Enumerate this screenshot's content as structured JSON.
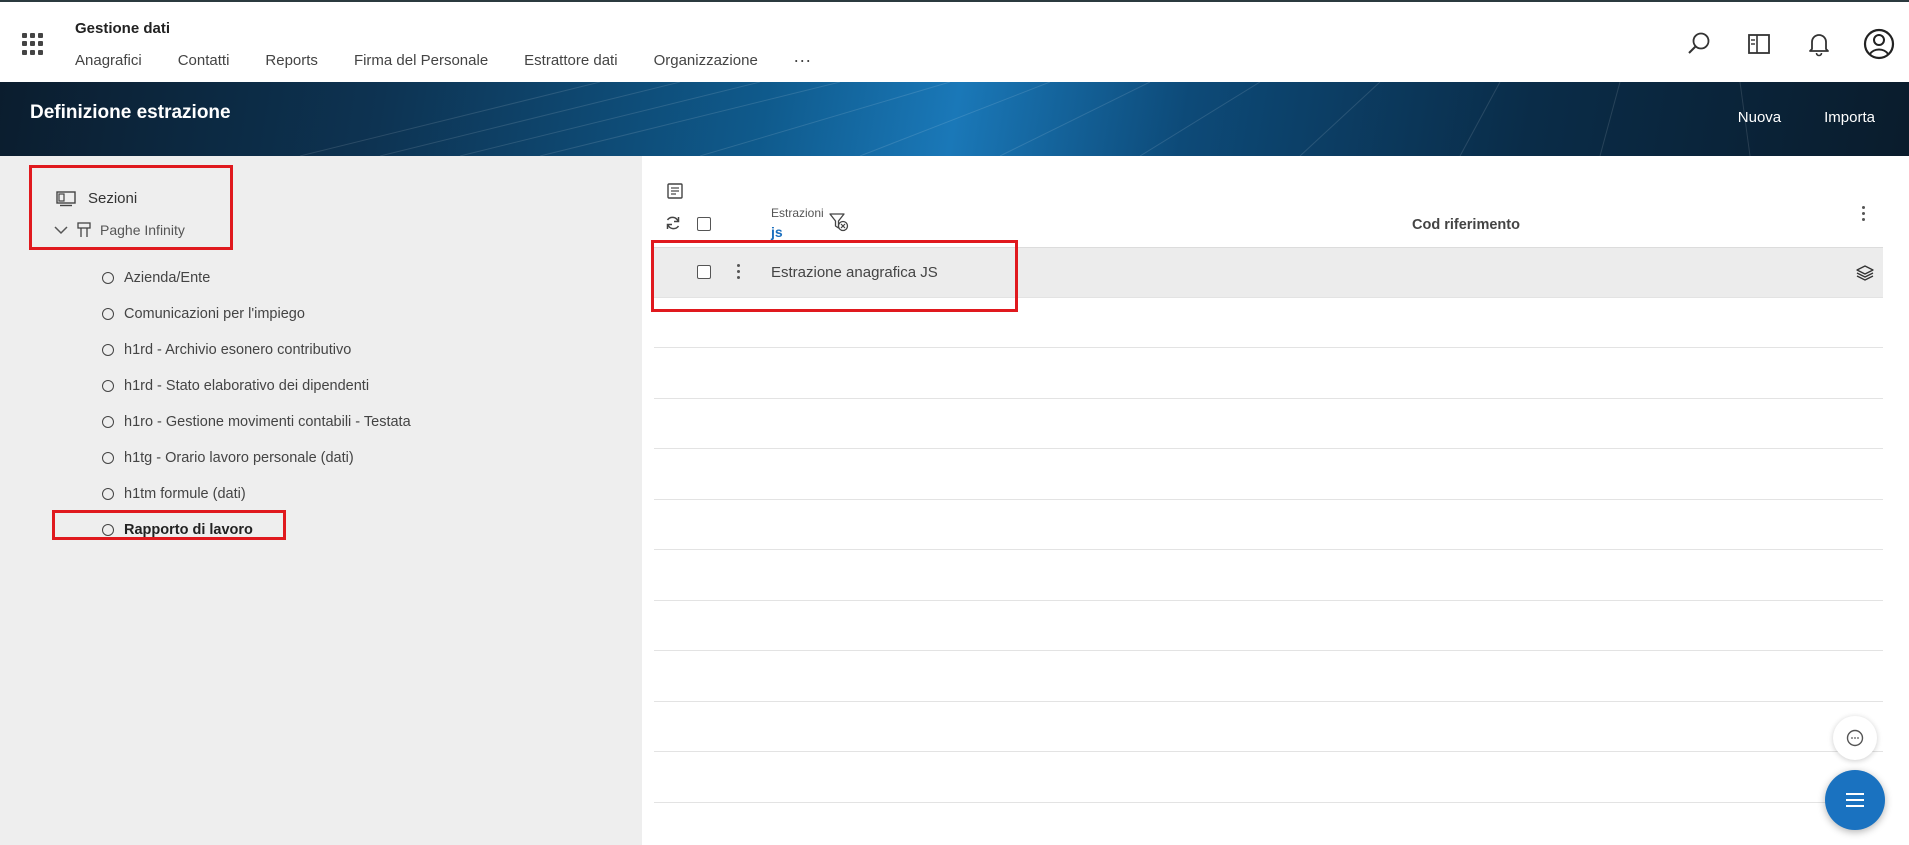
{
  "header": {
    "app_title": "Gestione dati",
    "nav": [
      "Anagrafici",
      "Contatti",
      "Reports",
      "Firma del Personale",
      "Estrattore dati",
      "Organizzazione"
    ],
    "nav_more": "..."
  },
  "banner": {
    "title": "Definizione estrazione",
    "actions": {
      "new": "Nuova",
      "import": "Importa"
    }
  },
  "tree": {
    "root": "Sezioni",
    "group": "Paghe Infinity",
    "items": [
      "Azienda/Ente",
      "Comunicazioni per l'impiego",
      "h1rd - Archivio esonero contributivo",
      "h1rd - Stato elaborativo dei dipendenti",
      "h1ro - Gestione movimenti contabili - Testata",
      "h1tg - Orario lavoro personale (dati)",
      "h1tm formule (dati)",
      "Rapporto di lavoro"
    ],
    "active_index": 7
  },
  "grid": {
    "col_estrazioni": "Estrazioni",
    "filter_value": "js",
    "col_cod": "Cod riferimento",
    "rows": [
      "Estrazione anagrafica JS"
    ]
  },
  "colors": {
    "accent": "#1a72c0",
    "highlight_box": "#e0191e"
  }
}
